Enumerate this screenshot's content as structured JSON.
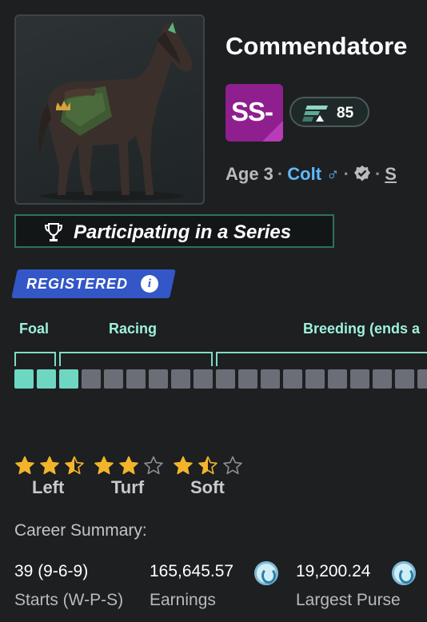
{
  "horse": {
    "name": "Commendatore",
    "grade": "SS-",
    "rating": "85",
    "age": "Age 3",
    "sex": "Colt",
    "sex_symbol": "♂",
    "partial_next": "S"
  },
  "series_banner": "Participating in a Series",
  "registered_badge": "REGISTERED",
  "registered_info": "i",
  "lifecycle": {
    "phases": [
      "Foal",
      "Racing",
      "Breeding (ends a"
    ],
    "filled_cells": 3,
    "total_cells": 19
  },
  "preferences": [
    {
      "label": "Left",
      "stars": 2.5
    },
    {
      "label": "Turf",
      "stars": 2
    },
    {
      "label": "Soft",
      "stars": 1.5
    }
  ],
  "career": {
    "title": "Career Summary:",
    "stats": [
      {
        "value": "39 (9-6-9)",
        "label": "Starts (W-P-S)"
      },
      {
        "value": "165,645.57",
        "label": "Earnings"
      },
      {
        "value": "19,200.24",
        "label": "Largest Purse"
      }
    ]
  },
  "colors": {
    "accent": "#6ed7c2",
    "registered": "#3357c7",
    "grade": "#8f1f8f",
    "colt": "#5fb8ff"
  },
  "icons": [
    "trophy-icon",
    "info-icon",
    "verified-icon",
    "star-icon",
    "coin-icon",
    "rating-icon",
    "male-icon"
  ]
}
